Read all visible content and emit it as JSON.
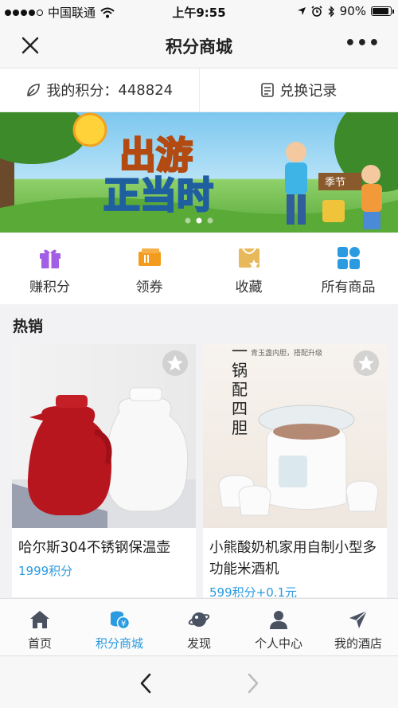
{
  "status_bar": {
    "carrier": "中国联通",
    "time": "上午9:55",
    "battery": "90%",
    "battery_level": 0.9
  },
  "nav": {
    "title": "积分商城",
    "more": "•••"
  },
  "points": {
    "label": "我的积分：",
    "value": "448824",
    "history_label": "兑换记录"
  },
  "banner": {
    "headline_top": "出游",
    "headline_bottom": "正当时",
    "sign_text": "季节",
    "page_index": 1,
    "page_count": 3
  },
  "categories": [
    {
      "label": "赚积分",
      "icon": "gift-icon",
      "color": "#a35ee6"
    },
    {
      "label": "领券",
      "icon": "coupon-icon",
      "color": "#f39b1c"
    },
    {
      "label": "收藏",
      "icon": "favorite-box-icon",
      "color": "#e8b95a"
    },
    {
      "label": "所有商品",
      "icon": "grid-icon",
      "color": "#2a9be0"
    }
  ],
  "section": {
    "hot_title": "热销"
  },
  "products": [
    {
      "name": "哈尔斯304不锈钢保温壶",
      "price": "1999积分"
    },
    {
      "name": "小熊酸奶机家用自制小型多功能米酒机",
      "price": "599积分+0.1元",
      "image_text": [
        "一",
        "锅",
        "配",
        "四",
        "胆"
      ],
      "image_subtext": "青玉盏内胆，搭配升级"
    }
  ],
  "tabbar": [
    {
      "label": "首页",
      "icon": "home-icon",
      "active": false
    },
    {
      "label": "积分商城",
      "icon": "coins-icon",
      "active": true
    },
    {
      "label": "发现",
      "icon": "planet-icon",
      "active": false
    },
    {
      "label": "个人中心",
      "icon": "user-icon",
      "active": false
    },
    {
      "label": "我的酒店",
      "icon": "send-icon",
      "active": false
    }
  ],
  "colors": {
    "accent": "#2a9be0",
    "background": "#f2f2f4"
  }
}
